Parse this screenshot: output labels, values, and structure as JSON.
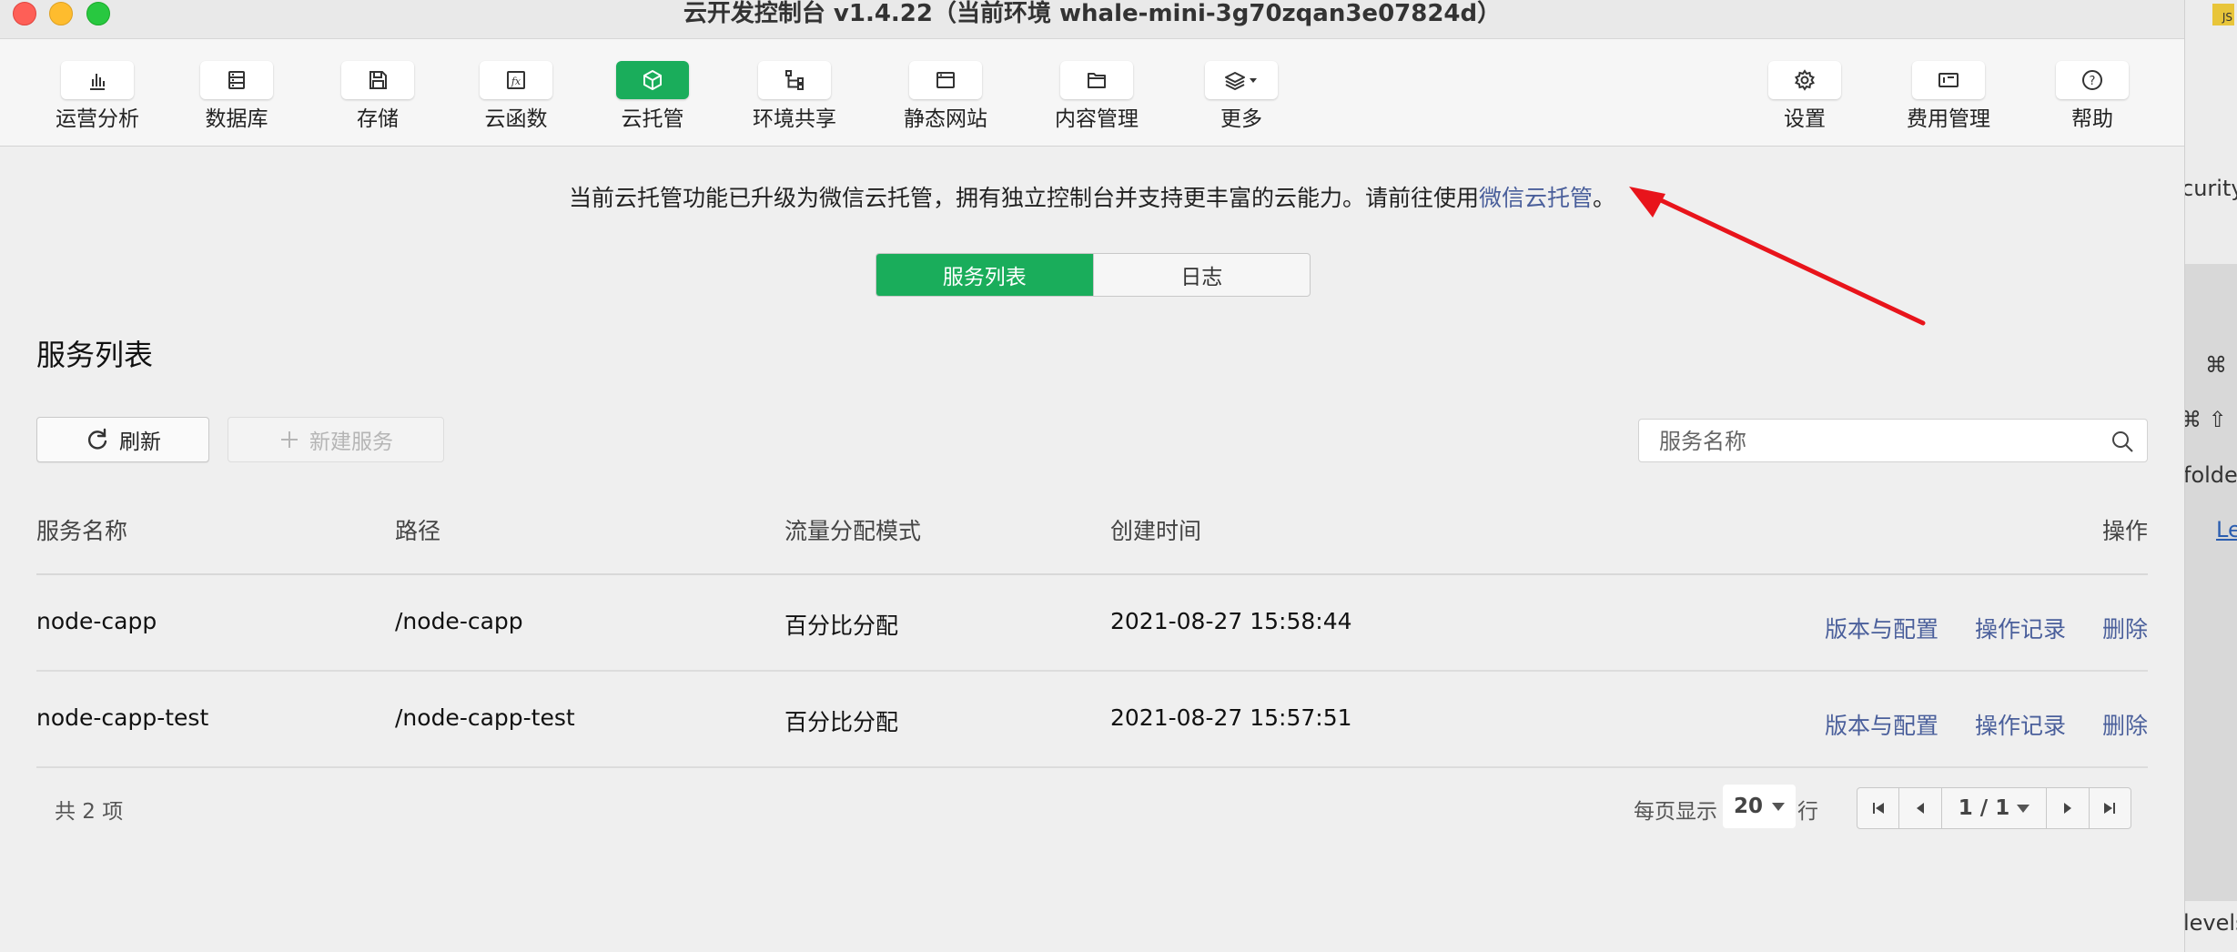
{
  "window": {
    "title": "云开发控制台 v1.4.22（当前环境 whale-mini-3g70zqan3e07824d）"
  },
  "toolbar": {
    "items": [
      {
        "label": "运营分析",
        "icon": "bar-chart-icon"
      },
      {
        "label": "数据库",
        "icon": "database-icon"
      },
      {
        "label": "存储",
        "icon": "save-icon"
      },
      {
        "label": "云函数",
        "icon": "function-icon"
      },
      {
        "label": "云托管",
        "icon": "cube-icon",
        "active": true
      },
      {
        "label": "环境共享",
        "icon": "share-tree-icon"
      },
      {
        "label": "静态网站",
        "icon": "browser-window-icon"
      },
      {
        "label": "内容管理",
        "icon": "folder-icon"
      },
      {
        "label": "更多",
        "icon": "layers-icon"
      },
      {
        "label": "设置",
        "icon": "gear-icon"
      },
      {
        "label": "费用管理",
        "icon": "billing-icon"
      },
      {
        "label": "帮助",
        "icon": "help-icon"
      }
    ]
  },
  "notice": {
    "text": "当前云托管功能已升级为微信云托管，拥有独立控制台并支持更丰富的云能力。请前往使用",
    "link": "微信云托管",
    "suffix": "。"
  },
  "tabs": [
    {
      "label": "服务列表",
      "active": true
    },
    {
      "label": "日志",
      "active": false
    }
  ],
  "section_title": "服务列表",
  "actions": {
    "refresh": "刷新",
    "new_service": "新建服务"
  },
  "search": {
    "placeholder": "服务名称"
  },
  "table": {
    "headers": [
      "服务名称",
      "路径",
      "流量分配模式",
      "创建时间",
      "操作"
    ],
    "rows": [
      {
        "name": "node-capp",
        "path": "/node-capp",
        "mode": "百分比分配",
        "created": "2021-08-27 15:58:44"
      },
      {
        "name": "node-capp-test",
        "path": "/node-capp-test",
        "mode": "百分比分配",
        "created": "2021-08-27 15:57:51"
      }
    ],
    "row_actions": [
      "版本与配置",
      "操作记录",
      "删除"
    ]
  },
  "footer": {
    "total": "共 2 项",
    "page_size_label": "每页显示",
    "page_size": "20",
    "row_unit": "行",
    "page_indicator": "1 / 1"
  },
  "background_window": {
    "lines": [
      "curity",
      "⌘",
      "⌘ ⇧",
      "folde",
      "Le",
      "levels"
    ],
    "badge": "JS"
  },
  "colors": {
    "accent_green": "#1aad5b",
    "link_blue": "#4a5f9b",
    "annotation_arrow": "#e8141b"
  }
}
